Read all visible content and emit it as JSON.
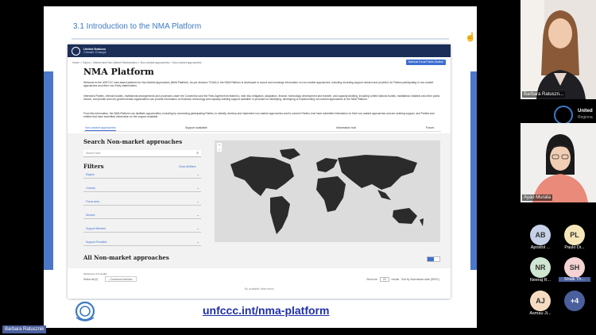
{
  "slide": {
    "title": "3.1 Introduction to the NMA Platform",
    "footer_link": "unfccc.int/nma-platform"
  },
  "website": {
    "org_name": "United Nations",
    "org_sub": "Climate Change",
    "breadcrumb": "Home  >  Topics  >  Market and Non-Market Mechanisms  >  Non-market approaches  >  Non-market approaches",
    "focal_button": "National Focal Points Section",
    "page_title": "NMA Platform",
    "intro_1": "Welcome to the UNFCCC web-based platform for Non-Market Approaches (NMA Platform). As per decision 7/CMA.4, the NMA Platform is developed to record and exchange information on non-market approaches, including recording support needed and provided, for Parties participating in non-market approaches and other non-Party stakeholders.",
    "intro_2": "Interested Parties, relevant bodies, institutional arrangements and processes under the Convention and the Paris Agreement related to, inter alia, mitigation, adaptation, finance, technology development and transfer, and capacity-building, including United Nations bodies, multilateral, bilateral and other public donors, and private and non-governmental organizations can provide information on financial, technology and capacity-building support available or provided for identifying, developing or implementing non-market approaches in the NMA Platform.",
    "intro_3": "From this information, the NMA Platform can facilitate opportunities, including by connecting participating Parties, to identify, develop and implement non-market approaches and to connect Parties, that have submitted information on their non-market approaches and are seeking support, and Parties and entities that have submitted information on the support available.",
    "tabs": [
      "Non-market approaches",
      "Support available",
      "Information hub",
      "Forum"
    ],
    "search_title": "Search Non-market approaches",
    "search_placeholder": "Search here",
    "filters_title": "Filters",
    "clear_filters": "Clear all filters",
    "filters": [
      "Region",
      "Country",
      "Focus area",
      "Sectors",
      "Support Needed",
      "Support Provided"
    ],
    "all_title": "All Non-market approaches",
    "showing": "Showing 0 of 0 results",
    "select_all": "Select all (0)",
    "download_button": "Download selection",
    "show_label": "Show me",
    "show_value": "20",
    "results_label": "results",
    "sort_label": "Sort by",
    "sort_value": "Submission date (DESC)",
    "no_data": "No available data found"
  },
  "presenter_tag": "Barbara Ratusznik",
  "participants": {
    "video_1": "Barbara Ratuszn...",
    "video_2": "Ayao Murata",
    "unfccc_title": "United",
    "unfccc_sub": "Regiona",
    "avatars": [
      {
        "initials": "AB",
        "label": "Apostol ...",
        "color": "#c7d2e8"
      },
      {
        "initials": "PL",
        "label": "Paulo Di...",
        "color": "#f5e6b8"
      },
      {
        "initials": "NR",
        "label": "Neeraj R...",
        "color": "#cfe7d2"
      },
      {
        "initials": "SH",
        "label": "Shaik Th...",
        "color": "#f5d3d3"
      },
      {
        "initials": "AJ",
        "label": "Asmau Ji...",
        "color": "#f5dcc0"
      },
      {
        "initials": "+4",
        "label": "",
        "color": "#4a5f9c"
      }
    ]
  }
}
